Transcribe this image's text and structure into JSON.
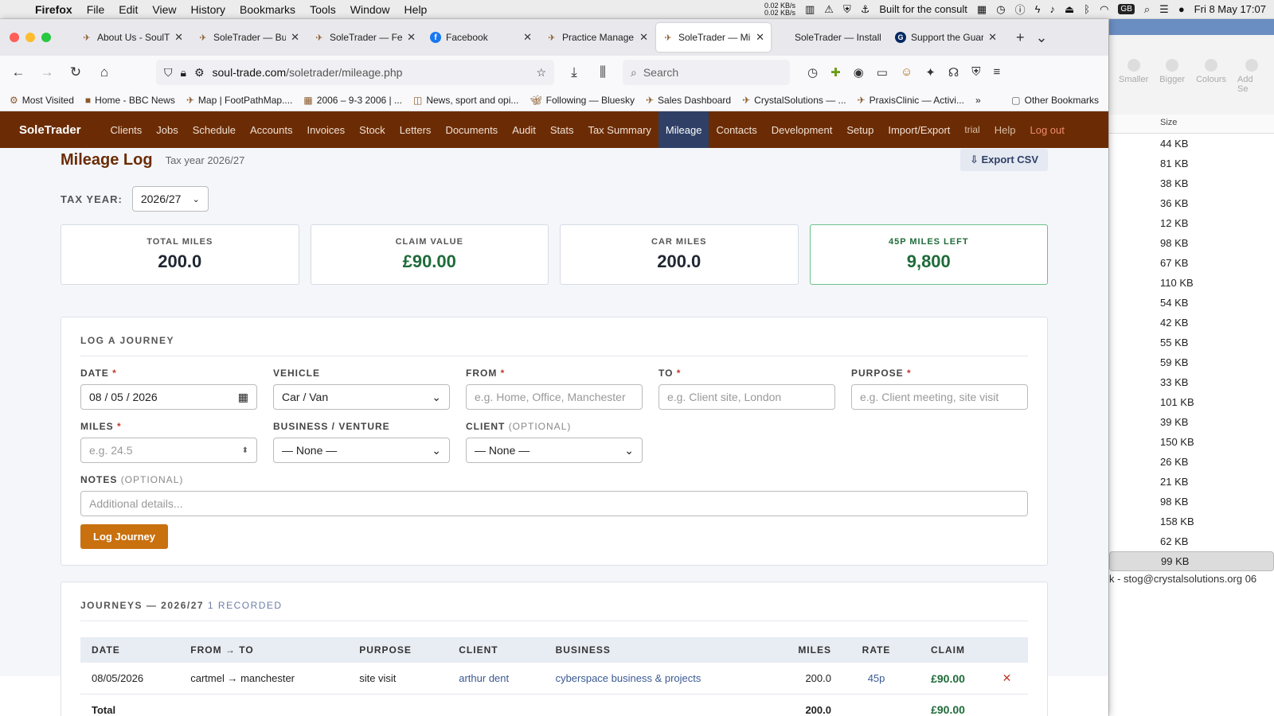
{
  "menubar": {
    "app": "Firefox",
    "items": [
      "File",
      "Edit",
      "View",
      "History",
      "Bookmarks",
      "Tools",
      "Window",
      "Help"
    ],
    "netspeed_up": "0.02 KB/s",
    "netspeed_down": "0.02 KB/s",
    "status_text": "Built for the consult",
    "input_source": "GB",
    "datetime": "Fri 8 May  17:07"
  },
  "bg_window": {
    "tools": [
      "Smaller",
      "Bigger",
      "Colours",
      "Add Se"
    ],
    "column_header": "Size",
    "sizes": [
      "44 KB",
      "81 KB",
      "38 KB",
      "36 KB",
      "12 KB",
      "98 KB",
      "67 KB",
      "110 KB",
      "54 KB",
      "42 KB",
      "55 KB",
      "59 KB",
      "33 KB",
      "101 KB",
      "39 KB",
      "150 KB",
      "26 KB",
      "21 KB",
      "98 KB",
      "158 KB",
      "62 KB",
      "99 KB"
    ],
    "selected_index": 21,
    "email_row": "k - stog@crystalsolutions.org    06"
  },
  "tabs": [
    {
      "title": "About Us - SoulT",
      "icon": "soletrader-icon"
    },
    {
      "title": "SoleTrader — Bu",
      "icon": "soletrader-icon"
    },
    {
      "title": "SoleTrader — Fe",
      "icon": "soletrader-icon"
    },
    {
      "title": "Facebook",
      "icon": "facebook-icon"
    },
    {
      "title": "Practice Manage",
      "icon": "soletrader-icon"
    },
    {
      "title": "SoleTrader — Mil",
      "icon": "soletrader-icon",
      "active": true
    },
    {
      "title": "SoleTrader — Installa",
      "icon": "none"
    },
    {
      "title": "Support the Guar",
      "icon": "guardian-icon"
    }
  ],
  "url": {
    "host": "soul-trade.com",
    "path": "/soletrader/mileage.php"
  },
  "search_placeholder": "Search",
  "bookmarks": [
    "Most Visited",
    "Home - BBC News",
    "Map | FootPathMap....",
    "2006 – 9-3 2006 | ...",
    "News, sport and opi...",
    "Following — Bluesky",
    "Sales Dashboard",
    "CrystalSolutions — ...",
    "PraxisClinic — Activi..."
  ],
  "other_bookmarks": "Other Bookmarks",
  "app": {
    "brand": "SoleTrader",
    "nav": [
      "Clients",
      "Jobs",
      "Schedule",
      "Accounts",
      "Invoices",
      "Stock",
      "Letters",
      "Documents",
      "Audit",
      "Stats",
      "Tax Summary",
      "Mileage",
      "Contacts",
      "Development",
      "Setup",
      "Import/Export"
    ],
    "active_nav": "Mileage",
    "trial": "trial",
    "help": "Help",
    "logout": "Log out"
  },
  "page": {
    "title": "Mileage Log",
    "subtitle": "Tax year 2026/27",
    "export_label": "Export CSV",
    "tax_year_label": "TAX YEAR:",
    "tax_year_value": "2026/27"
  },
  "stats": [
    {
      "label": "TOTAL MILES",
      "value": "200.0"
    },
    {
      "label": "CLAIM VALUE",
      "value": "£90.00"
    },
    {
      "label": "CAR MILES",
      "value": "200.0"
    },
    {
      "label": "45P MILES LEFT",
      "value": "9,800"
    }
  ],
  "form": {
    "title": "LOG A JOURNEY",
    "date_label": "DATE",
    "date_value": "08 / 05 / 2026",
    "vehicle_label": "VEHICLE",
    "vehicle_value": "Car / Van",
    "from_label": "FROM",
    "from_placeholder": "e.g. Home, Office, Manchester",
    "to_label": "TO",
    "to_placeholder": "e.g. Client site, London",
    "purpose_label": "PURPOSE",
    "purpose_placeholder": "e.g. Client meeting, site visit",
    "miles_label": "MILES",
    "miles_placeholder": "e.g. 24.5",
    "business_label": "BUSINESS / VENTURE",
    "business_value": "— None —",
    "client_label": "CLIENT",
    "client_value": "— None —",
    "notes_label": "NOTES",
    "notes_placeholder": "Additional details...",
    "optional": "(OPTIONAL)",
    "required_mark": "*",
    "submit_label": "Log Journey"
  },
  "journeys": {
    "title": "JOURNEYS — 2026/27",
    "count": "1 RECORDED",
    "columns": [
      "DATE",
      "FROM → TO",
      "PURPOSE",
      "CLIENT",
      "BUSINESS",
      "MILES",
      "RATE",
      "CLAIM"
    ],
    "rows": [
      {
        "date": "08/05/2026",
        "route": "cartmel → manchester",
        "purpose": "site visit",
        "client": "arthur dent",
        "business": "cyberspace business & projects",
        "miles": "200.0",
        "rate": "45p",
        "claim": "£90.00"
      }
    ],
    "total_label": "Total",
    "total_miles": "200.0",
    "total_claim": "£90.00"
  }
}
